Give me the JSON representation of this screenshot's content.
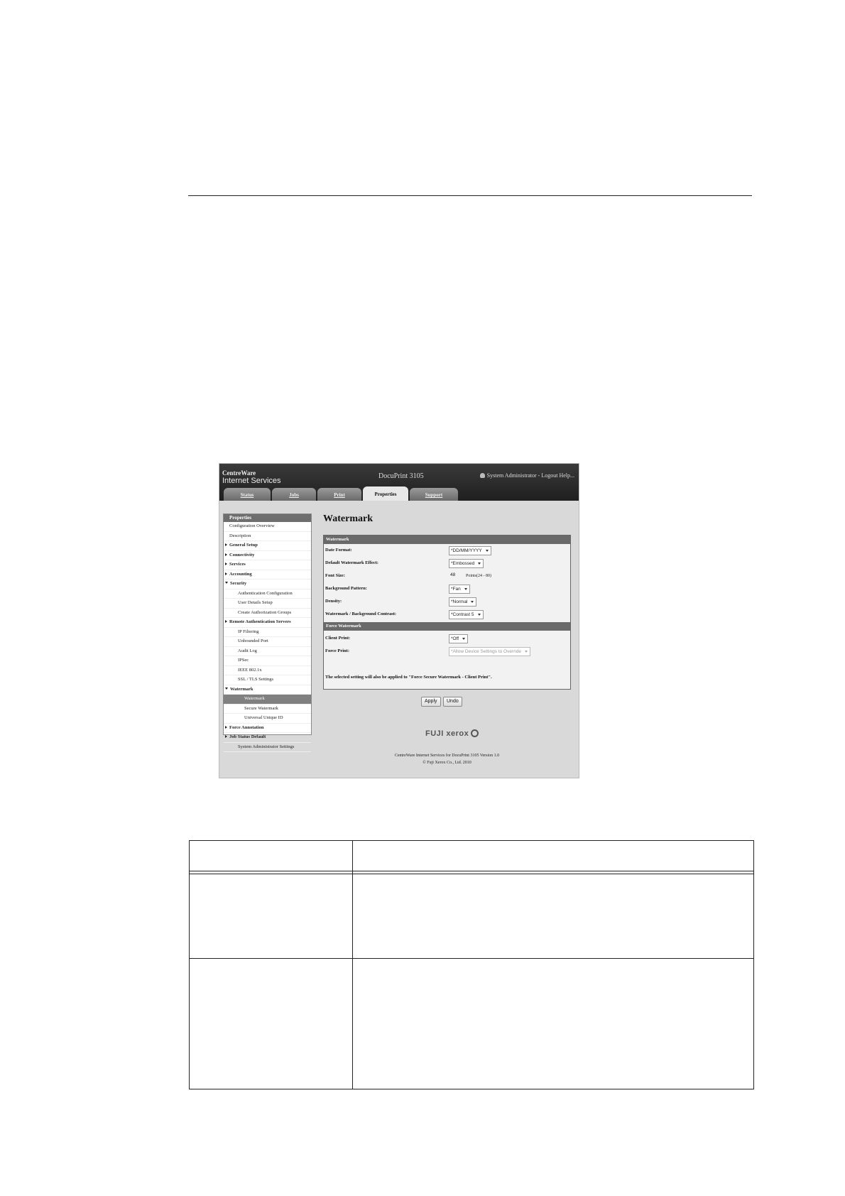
{
  "window": {
    "brand_line1": "CentreWare",
    "brand_line2": "Internet Services",
    "device": "DocuPrint 3105",
    "admin_bar": "System Administrator - Logout Help..."
  },
  "tabs": [
    {
      "label": "Status"
    },
    {
      "label": "Jobs"
    },
    {
      "label": "Print"
    },
    {
      "label": "Properties",
      "active": true
    },
    {
      "label": "Support"
    }
  ],
  "sidebar": {
    "title": "Properties",
    "items": [
      {
        "label": "Configuration Overview",
        "indent": 1
      },
      {
        "label": "Description",
        "indent": 1
      },
      {
        "label": "General Setup",
        "indent": 0,
        "arrow": "right",
        "bold": true
      },
      {
        "label": "Connectivity",
        "indent": 0,
        "arrow": "right",
        "bold": true
      },
      {
        "label": "Services",
        "indent": 0,
        "arrow": "right",
        "bold": true
      },
      {
        "label": "Accounting",
        "indent": 0,
        "arrow": "right",
        "bold": true
      },
      {
        "label": "Security",
        "indent": 0,
        "arrow": "down",
        "bold": true
      },
      {
        "label": "Authentication Configuration",
        "indent": 2
      },
      {
        "label": "User Details Setup",
        "indent": 2
      },
      {
        "label": "Create Authorization Groups",
        "indent": 2
      },
      {
        "label": "Remote Authentication Servers",
        "indent": 1,
        "arrow": "right",
        "bold": true
      },
      {
        "label": "IP Filtering",
        "indent": 2
      },
      {
        "label": "Unbounded Port",
        "indent": 2
      },
      {
        "label": "Audit Log",
        "indent": 2
      },
      {
        "label": "IPSec",
        "indent": 2
      },
      {
        "label": "IEEE 802.1x",
        "indent": 2
      },
      {
        "label": "SSL / TLS Settings",
        "indent": 2
      },
      {
        "label": "Watermark",
        "indent": 1,
        "arrow": "down",
        "bold": true
      },
      {
        "label": "Watermark",
        "indent": 3,
        "selected": true
      },
      {
        "label": "Secure Watermark",
        "indent": 3
      },
      {
        "label": "Universal Unique ID",
        "indent": 3
      },
      {
        "label": "Force Annotation",
        "indent": 1,
        "arrow": "right",
        "bold": true
      },
      {
        "label": "Job Status Default",
        "indent": 1,
        "arrow": "right",
        "bold": true
      },
      {
        "label": "System Administrator Settings",
        "indent": 2
      }
    ]
  },
  "main": {
    "title": "Watermark",
    "watermark_section": {
      "heading": "Watermark",
      "fields": [
        {
          "label": "Date Format:",
          "value": "*DD/MM/YYYY",
          "type": "select"
        },
        {
          "label": "Default Watermark Effect:",
          "value": "*Embossed",
          "type": "select"
        },
        {
          "label": "Font Size:",
          "value": "48",
          "type": "input",
          "note": "Points(24 - 80)"
        },
        {
          "label": "Background Pattern:",
          "value": "*Fan",
          "type": "select"
        },
        {
          "label": "Density:",
          "value": "*Normal",
          "type": "select"
        },
        {
          "label": "Watermark / Background Contrast:",
          "value": "*Contrast 5",
          "type": "select"
        }
      ]
    },
    "force_section": {
      "heading": "Force Watermark",
      "fields": [
        {
          "label": "Client Print:",
          "value": "*Off",
          "type": "select"
        },
        {
          "label": "Force Print:",
          "value": "*Allow Device Settings to Override",
          "type": "select",
          "disabled": true
        }
      ],
      "notice": "The selected setting will also be applied to \"Force Secure Watermark - Client Print\"."
    },
    "apply_label": "Apply",
    "undo_label": "Undo",
    "brand_logo": "FUJI xerox",
    "footer_line1": "CentreWare Internet Services for DocuPrint 3105 Version 1.0",
    "footer_line2": "© Fuji Xerox Co., Ltd. 2010"
  }
}
